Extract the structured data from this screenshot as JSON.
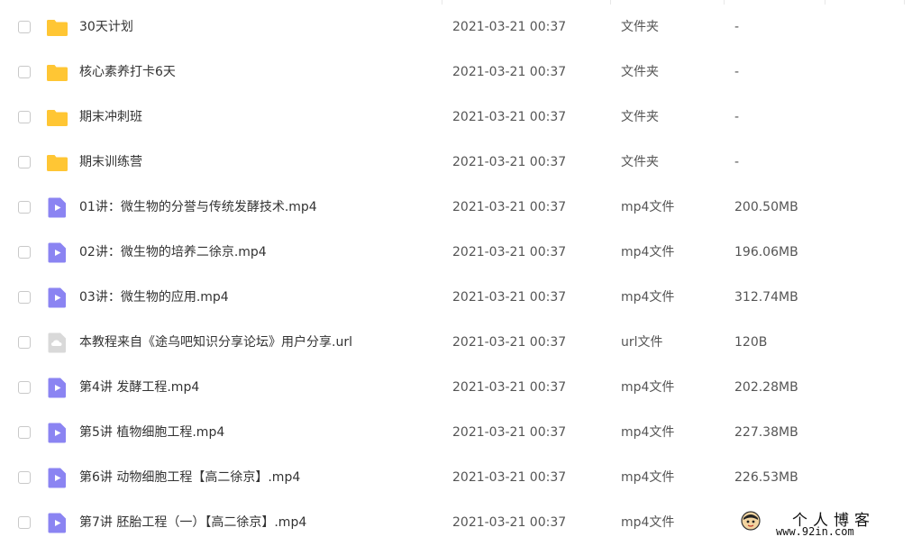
{
  "colors": {
    "folder": "#ffc634",
    "video": "#8b84f2",
    "url_file": "#d9d9d9",
    "text": "#333333",
    "meta_text": "#555555"
  },
  "files": [
    {
      "name": "30天计划",
      "date": "2021-03-21 00:37",
      "type": "文件夹",
      "size": "-",
      "icon": "folder-icon"
    },
    {
      "name": "核心素养打卡6天",
      "date": "2021-03-21 00:37",
      "type": "文件夹",
      "size": "-",
      "icon": "folder-icon"
    },
    {
      "name": "期末冲刺班",
      "date": "2021-03-21 00:37",
      "type": "文件夹",
      "size": "-",
      "icon": "folder-icon"
    },
    {
      "name": "期末训练营",
      "date": "2021-03-21 00:37",
      "type": "文件夹",
      "size": "-",
      "icon": "folder-icon"
    },
    {
      "name": "01讲：微生物的分誉与传统发酵技术.mp4",
      "date": "2021-03-21 00:37",
      "type": "mp4文件",
      "size": "200.50MB",
      "icon": "video-file-icon"
    },
    {
      "name": "02讲：微生物的培养二徐京.mp4",
      "date": "2021-03-21 00:37",
      "type": "mp4文件",
      "size": "196.06MB",
      "icon": "video-file-icon"
    },
    {
      "name": "03讲：微生物的应用.mp4",
      "date": "2021-03-21 00:37",
      "type": "mp4文件",
      "size": "312.74MB",
      "icon": "video-file-icon"
    },
    {
      "name": "本教程来自《途乌吧知识分享论坛》用户分享.url",
      "date": "2021-03-21 00:37",
      "type": "url文件",
      "size": "120B",
      "icon": "url-file-icon"
    },
    {
      "name": "第4讲 发酵工程.mp4",
      "date": "2021-03-21 00:37",
      "type": "mp4文件",
      "size": "202.28MB",
      "icon": "video-file-icon"
    },
    {
      "name": "第5讲 植物细胞工程.mp4",
      "date": "2021-03-21 00:37",
      "type": "mp4文件",
      "size": "227.38MB",
      "icon": "video-file-icon"
    },
    {
      "name": "第6讲 动物细胞工程【高二徐京】.mp4",
      "date": "2021-03-21 00:37",
      "type": "mp4文件",
      "size": "226.53MB",
      "icon": "video-file-icon"
    },
    {
      "name": "第7讲 胚胎工程（一）【高二徐京】.mp4",
      "date": "2021-03-21 00:37",
      "type": "mp4文件",
      "size": "",
      "icon": "video-file-icon"
    }
  ],
  "watermark": {
    "title": "个人博客",
    "url": "www.92in.com"
  }
}
